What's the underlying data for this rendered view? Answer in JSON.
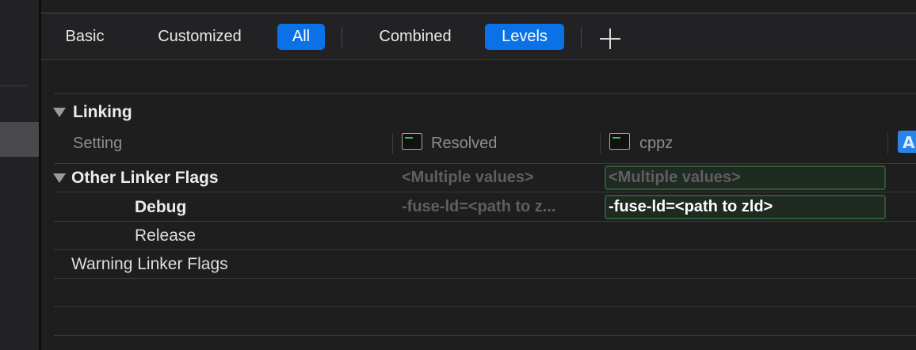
{
  "tabs": {
    "basic": "Basic",
    "customized": "Customized",
    "all": "All",
    "combined": "Combined",
    "levels": "Levels"
  },
  "section": {
    "title": "Linking"
  },
  "columns": {
    "setting": "Setting",
    "resolved": "Resolved",
    "target": "cppz"
  },
  "rows": [
    {
      "name": "Other Linker Flags",
      "resolved": "<Multiple values>",
      "target": "<Multiple values>"
    },
    {
      "name": "Debug",
      "resolved": "-fuse-ld=<path to z...",
      "target": "-fuse-ld=<path to zld>"
    },
    {
      "name": "Release"
    },
    {
      "name": "Warning Linker Flags"
    }
  ],
  "icons": {
    "plus": "plus-icon",
    "disclosure": "disclosure-triangle-icon",
    "terminal": "terminal-icon",
    "app": "app-store-icon"
  },
  "colors": {
    "accent": "#0a72e6",
    "highlight_border": "#2c5a34",
    "background": "#1e1e1f"
  }
}
